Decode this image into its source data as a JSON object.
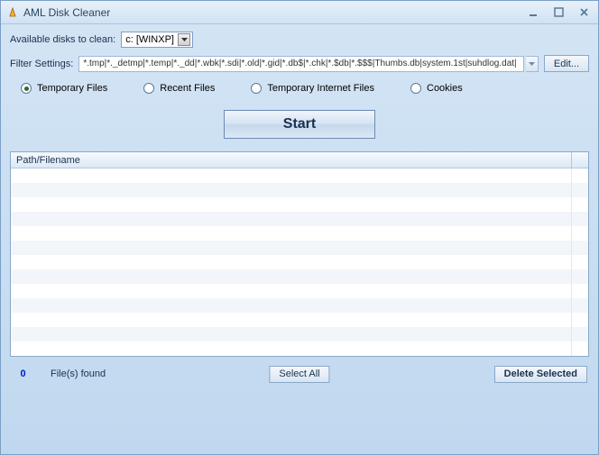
{
  "window": {
    "title": "AML Disk Cleaner"
  },
  "disks": {
    "label": "Available disks to clean:",
    "selected": "c: [WINXP]"
  },
  "filter": {
    "label": "Filter Settings:",
    "value": "*.tmp|*._detmp|*.temp|*._dd|*.wbk|*.sdi|*.old|*.gid|*.db$|*.chk|*.$db|*.$$$|Thumbs.db|system.1st|suhdlog.dat|",
    "edit_label": "Edit..."
  },
  "radios": {
    "temp": "Temporary Files",
    "recent": "Recent Files",
    "tif": "Temporary Internet Files",
    "cookies": "Cookies"
  },
  "start": {
    "label": "Start"
  },
  "list": {
    "col1": "Path/Filename"
  },
  "footer": {
    "count": "0",
    "found": "File(s) found",
    "select_all": "Select All",
    "delete": "Delete Selected"
  }
}
